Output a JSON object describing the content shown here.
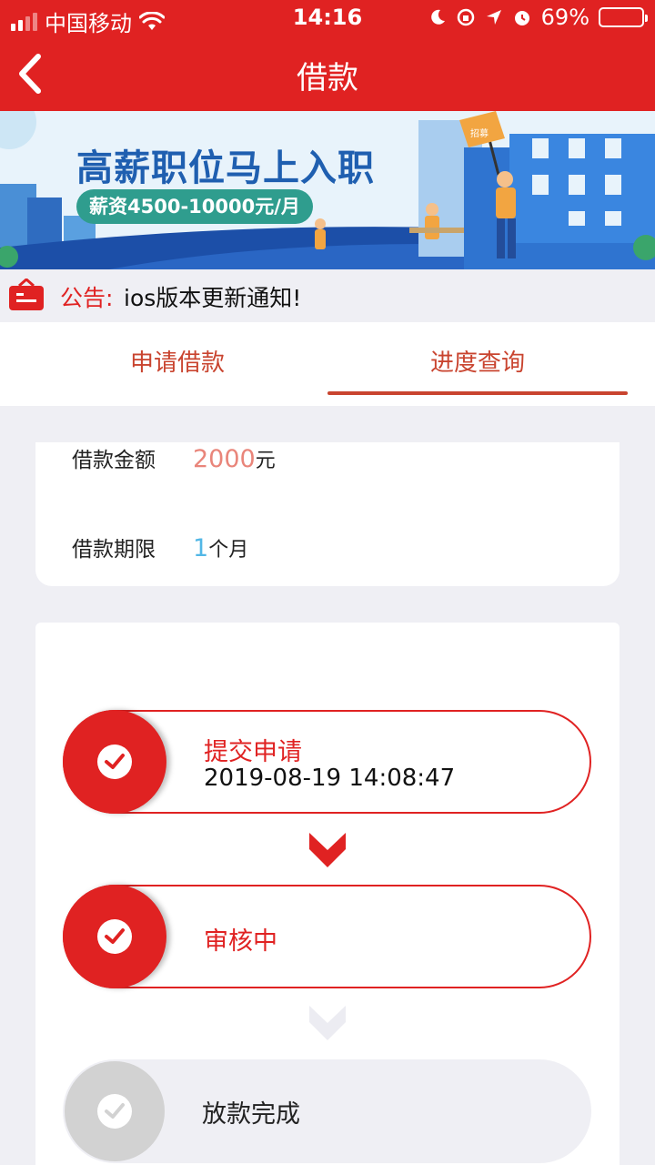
{
  "status_bar": {
    "carrier": "中国移动",
    "time": "14:16",
    "battery": "69%",
    "battery_level": 0.69
  },
  "nav": {
    "title": "借款",
    "back_icon": "chevron-left-icon"
  },
  "banner": {
    "headline": "高薪职位马上入职",
    "salary": "薪资4500-10000元/月",
    "flag_text": "招募"
  },
  "notice": {
    "label": "公告:",
    "text": "ios版本更新通知!"
  },
  "tabs": [
    {
      "label": "申请借款"
    },
    {
      "label": "进度查询"
    }
  ],
  "loan": {
    "amount_label": "借款金额",
    "amount_value": "2000",
    "amount_unit": "元",
    "term_label": "借款期限",
    "term_value": "1",
    "term_unit": "个月"
  },
  "steps": [
    {
      "title": "提交申请",
      "time": "2019-08-19 14:08:47"
    },
    {
      "title": "审核中"
    },
    {
      "title": "放款完成"
    }
  ],
  "colors": {
    "brand_red": "#e02222",
    "tab_accent": "#c9442f",
    "amount": "#e9857a",
    "term": "#52b7e6",
    "inactive": "#d2d2d2"
  }
}
